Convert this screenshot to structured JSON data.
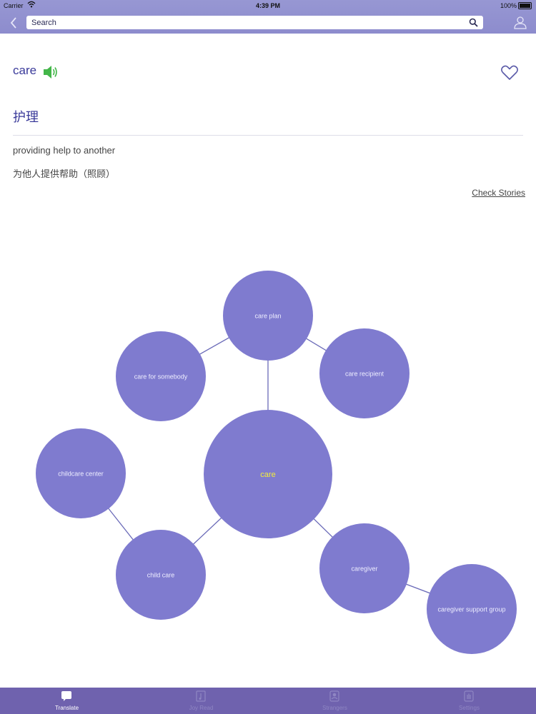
{
  "status_bar": {
    "carrier": "Carrier",
    "time": "4:39 PM",
    "battery": "100%"
  },
  "nav": {
    "search_placeholder": "Search",
    "back_icon": "chevron-left-icon",
    "search_icon": "magnifier-icon",
    "profile_icon": "user-icon"
  },
  "entry": {
    "word": "care",
    "translation": "护理",
    "definition_en": "providing help to another",
    "definition_zh": "为他人提供帮助（照顾）",
    "check_stories": "Check Stories"
  },
  "graph": {
    "center": "care",
    "nodes": [
      "care plan",
      "care for somebody",
      "care recipient",
      "childcare center",
      "child care",
      "caregiver",
      "caregiver support group"
    ]
  },
  "tabs": [
    {
      "label": "Translate",
      "active": true
    },
    {
      "label": "Joy Read",
      "active": false
    },
    {
      "label": "Strangers",
      "active": false
    },
    {
      "label": "Settings",
      "active": false
    }
  ],
  "colors": {
    "nav": "#8d8ccd",
    "node": "#7f7bcf",
    "center_text": "#f4ee3a",
    "tabbar": "#6f62ae",
    "accent_text": "#3a3a9a",
    "speaker": "#43b649"
  }
}
